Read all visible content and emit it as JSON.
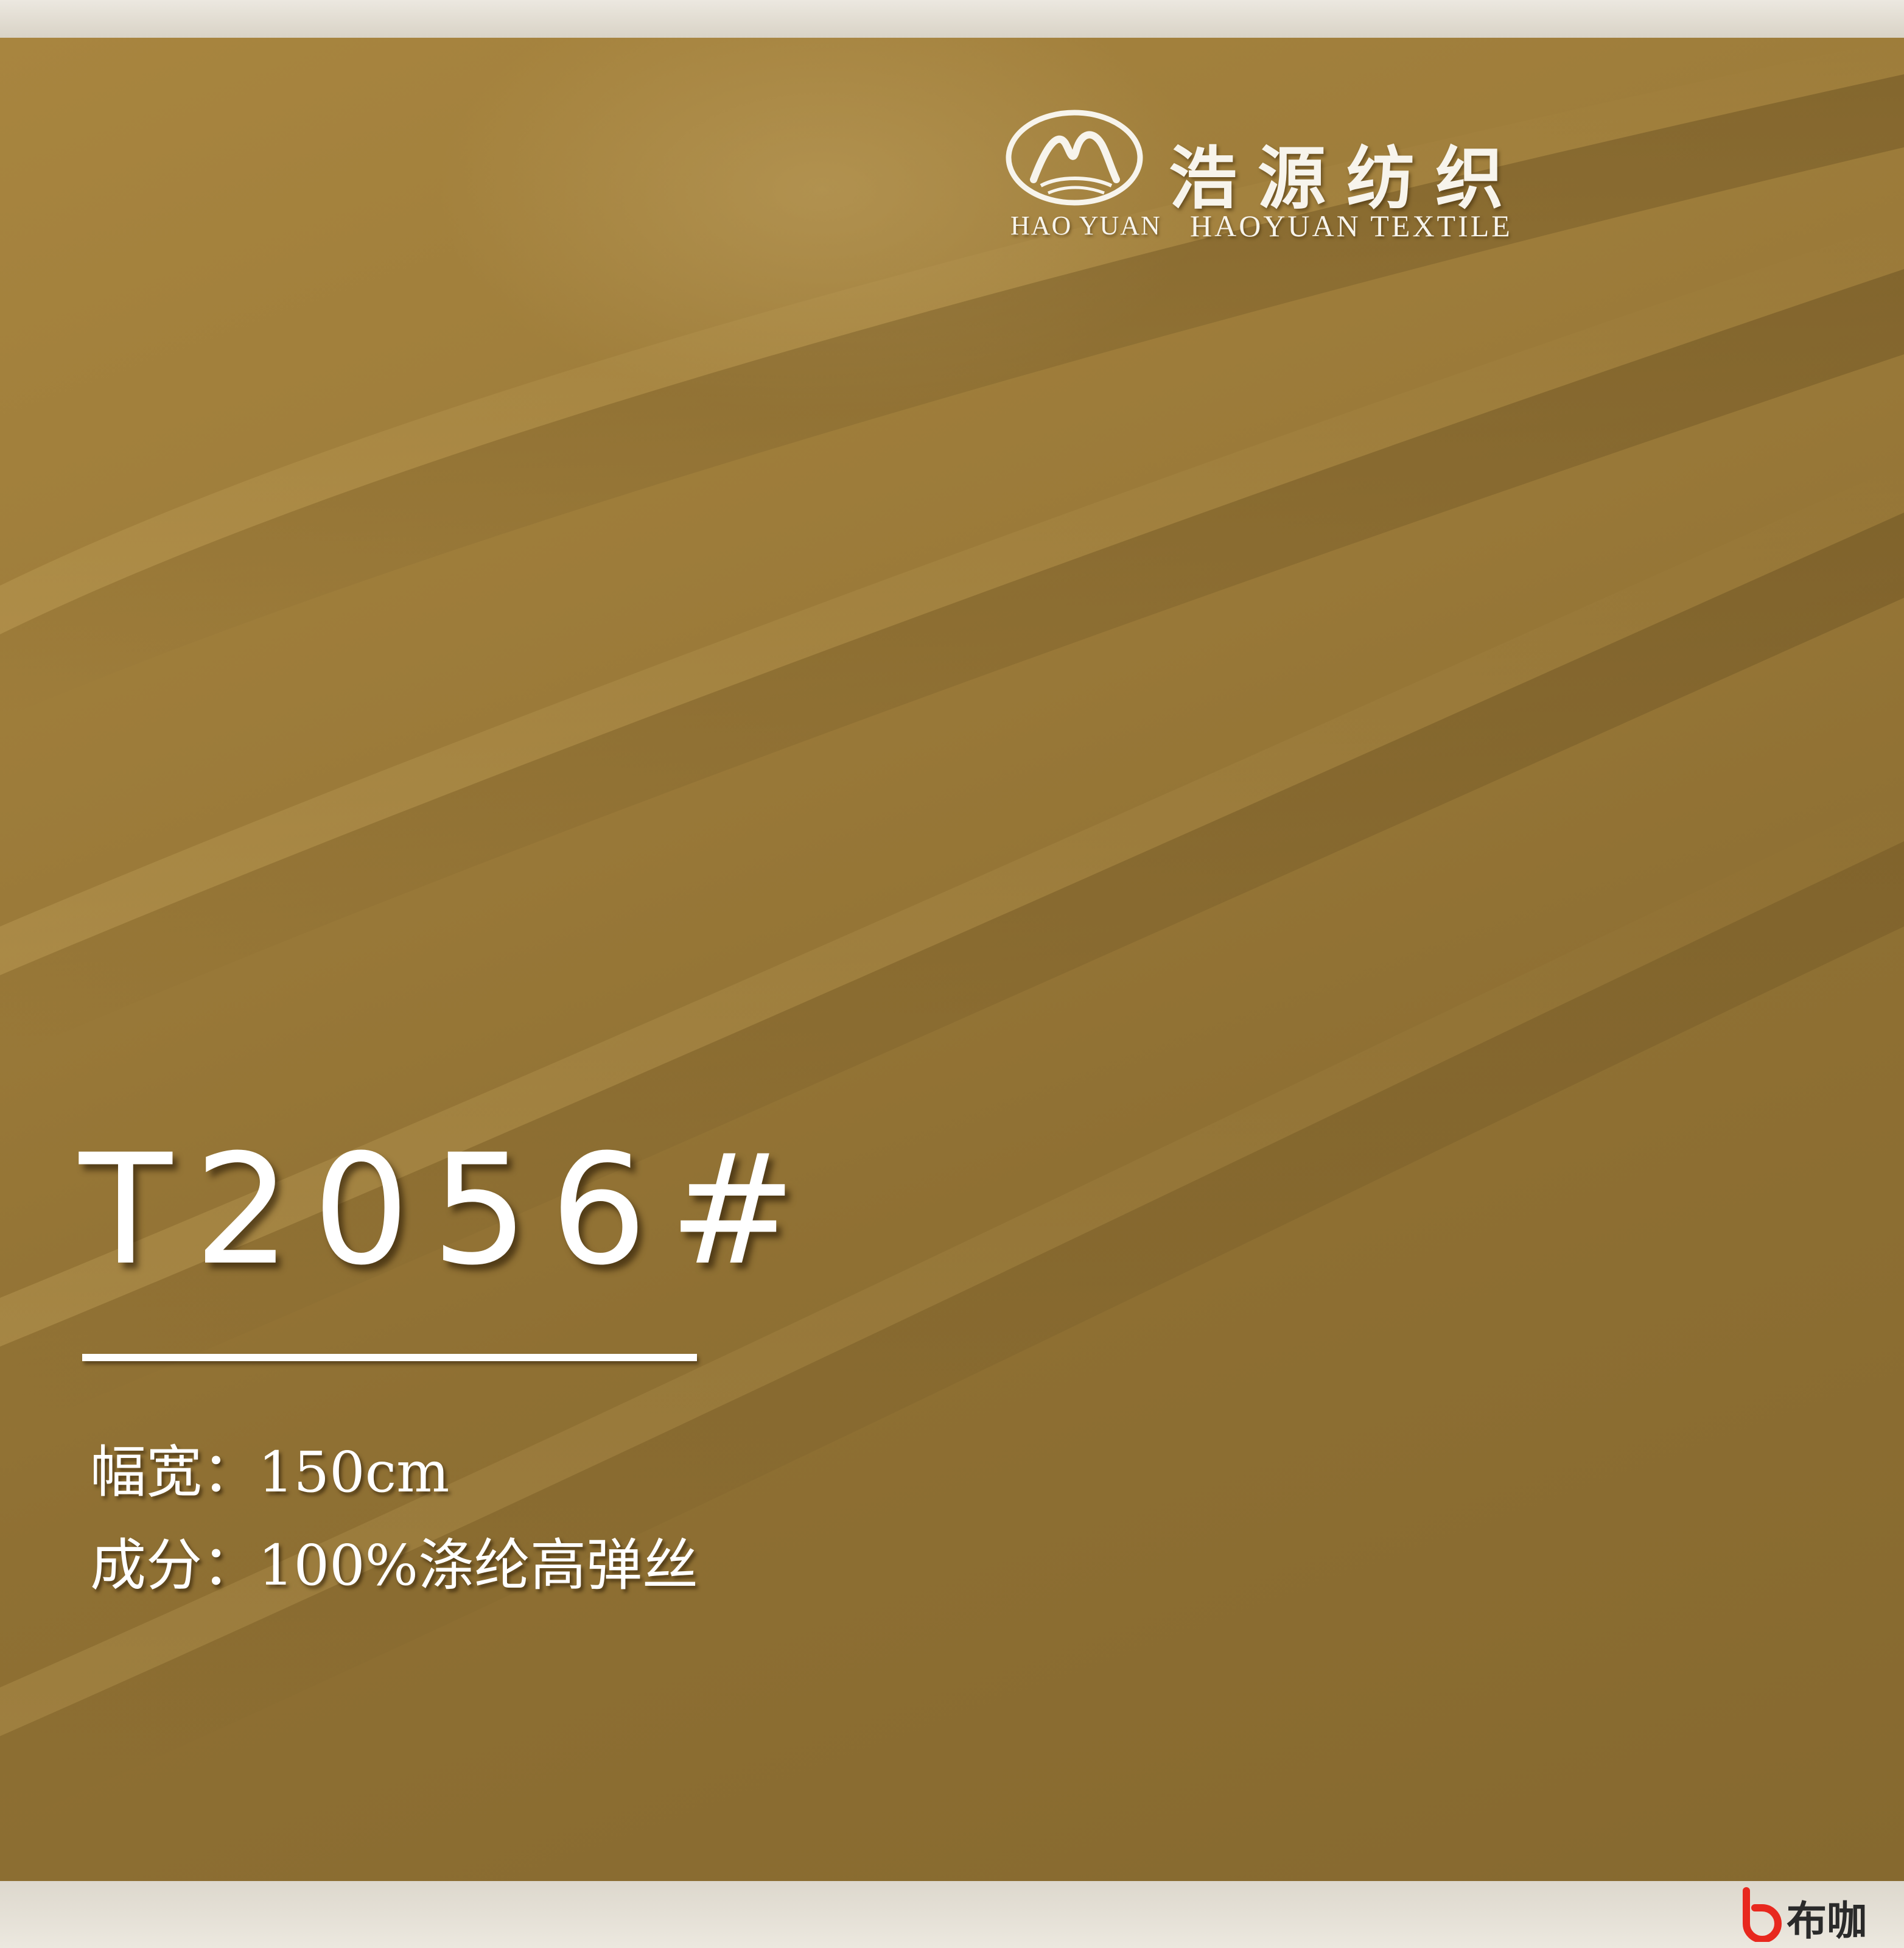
{
  "logo": {
    "name_cn": "浩源纺织",
    "brand_en": "HAO YUAN",
    "name_en": "HAOYUAN TEXTILE"
  },
  "product": {
    "code": "T2056#",
    "width_label": "幅宽：150cm",
    "composition_label": "成分：100%涤纶高弹丝"
  },
  "watermark": {
    "text": "布咖",
    "icon": "buka-b-icon",
    "color": "#e8281e"
  },
  "colors": {
    "fabric": "#9b7a38",
    "text": "#ffffff"
  }
}
